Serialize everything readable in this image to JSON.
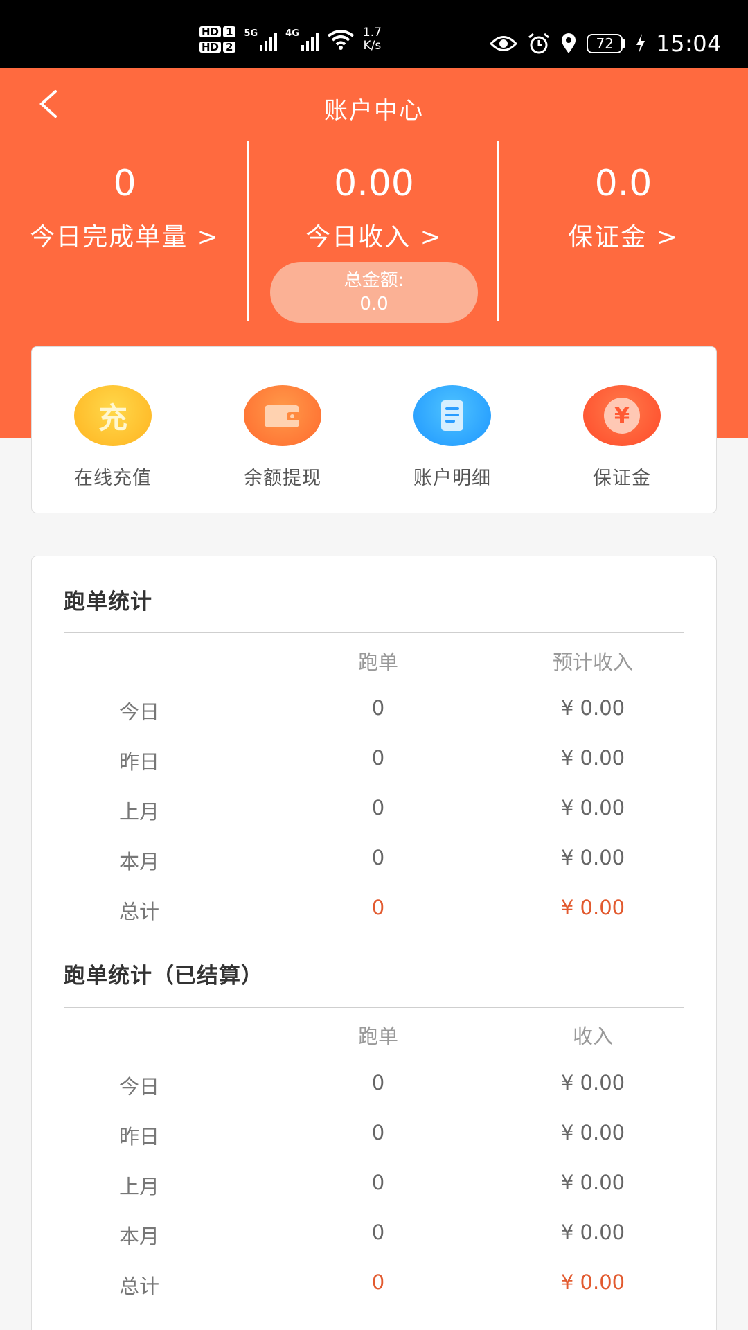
{
  "status_bar": {
    "hd1": "HD",
    "hd1_num": "1",
    "hd2": "HD",
    "hd2_num": "2",
    "net1": "5G",
    "net2": "4G",
    "speed_value": "1.7",
    "speed_unit": "K/s",
    "battery": "72",
    "time": "15:04",
    "icons": [
      "eye-icon",
      "alarm-icon",
      "location-icon",
      "wifi-icon",
      "charging-icon"
    ]
  },
  "header": {
    "title": "账户中心",
    "stats": [
      {
        "value": "0",
        "label": "今日完成单量 >"
      },
      {
        "value": "0.00",
        "label": "今日收入 >"
      },
      {
        "value": "0.0",
        "label": "保证金 >"
      }
    ],
    "total_label": "总金额:",
    "total_value": "0.0"
  },
  "quick_actions": [
    {
      "label": "在线充值",
      "icon": "recharge-icon",
      "glyph": "充",
      "color": "#ffbf1f"
    },
    {
      "label": "余额提现",
      "icon": "wallet-icon",
      "color": "#ff7a35"
    },
    {
      "label": "账户明细",
      "icon": "document-icon",
      "color": "#23a6ff"
    },
    {
      "label": "保证金",
      "icon": "yen-coin-icon",
      "glyph": "¥",
      "color": "#ff5a34"
    }
  ],
  "run_stats": {
    "title": "跑单统计",
    "col_orders": "跑单",
    "col_income": "预计收入",
    "rows": [
      {
        "label": "今日",
        "orders": "0",
        "income": "¥  0.00"
      },
      {
        "label": "昨日",
        "orders": "0",
        "income": "¥  0.00"
      },
      {
        "label": "上月",
        "orders": "0",
        "income": "¥  0.00"
      },
      {
        "label": "本月",
        "orders": "0",
        "income": "¥  0.00"
      },
      {
        "label": "总计",
        "orders": "0",
        "income": "¥  0.00"
      }
    ]
  },
  "settled_stats": {
    "title": "跑单统计（已结算）",
    "col_orders": "跑单",
    "col_income": "收入",
    "rows": [
      {
        "label": "今日",
        "orders": "0",
        "income": "¥  0.00"
      },
      {
        "label": "昨日",
        "orders": "0",
        "income": "¥  0.00"
      },
      {
        "label": "上月",
        "orders": "0",
        "income": "¥  0.00"
      },
      {
        "label": "本月",
        "orders": "0",
        "income": "¥  0.00"
      },
      {
        "label": "总计",
        "orders": "0",
        "income": "¥  0.00"
      }
    ]
  },
  "colors": {
    "accent": "#ff6a3f",
    "total_highlight": "#e25a2f"
  }
}
